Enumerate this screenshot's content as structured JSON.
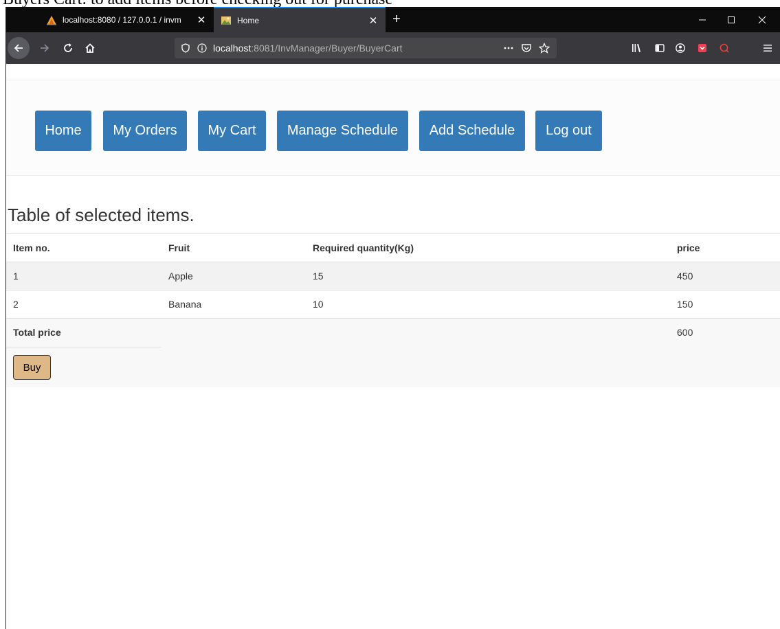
{
  "caption": "Buyers Cart: to add items before checking out for purchase",
  "browser": {
    "tabs": [
      {
        "title": "localhost:8080 / 127.0.0.1 / invm",
        "active": false,
        "favicon": "phpmyadmin-sail-icon"
      },
      {
        "title": "Home",
        "active": true,
        "favicon": "page-image-icon"
      }
    ],
    "url_host": "localhost",
    "url_rest": ":8081/InvManager/Buyer/BuyerCart",
    "accent": "#0a84ff"
  },
  "nav": {
    "buttons": [
      "Home",
      "My Orders",
      "My Cart",
      "Manage Schedule",
      "Add Schedule",
      "Log out"
    ],
    "color": "#337ab7"
  },
  "heading": "Table of selected items.",
  "table": {
    "headers": [
      "Item no.",
      "Fruit",
      "Required quantity(Kg)",
      "price"
    ],
    "rows": [
      [
        "1",
        "Apple",
        "15",
        "450"
      ],
      [
        "2",
        "Banana",
        "10",
        "150"
      ]
    ],
    "total_label": "Total price",
    "total_value": "600"
  },
  "buy_label": "Buy",
  "buy_color": "#deb887"
}
